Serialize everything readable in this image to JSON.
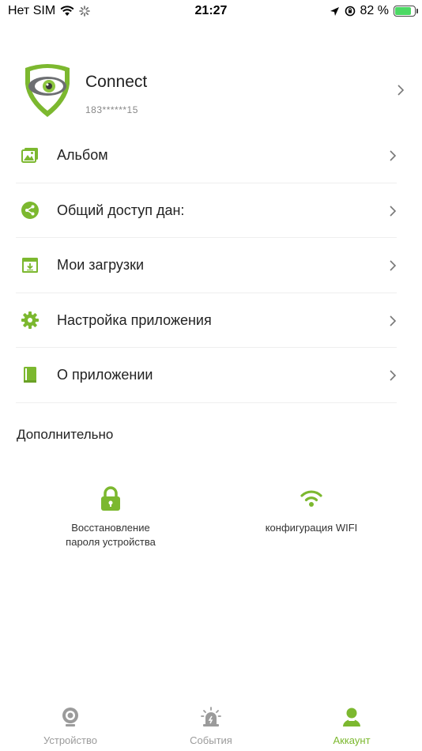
{
  "status_bar": {
    "carrier": "Нет SIM",
    "time": "21:27",
    "battery_percent": "82 %",
    "battery_level": 0.82
  },
  "profile": {
    "name": "Connect",
    "account_id": "183******15"
  },
  "menu": {
    "items": [
      {
        "label": "Альбом",
        "icon": "album-icon"
      },
      {
        "label": "Общий доступ дан:",
        "icon": "share-icon"
      },
      {
        "label": "Мои загрузки",
        "icon": "downloads-icon"
      },
      {
        "label": "Настройка приложения",
        "icon": "gear-icon"
      },
      {
        "label": "О приложении",
        "icon": "book-icon"
      }
    ]
  },
  "additional": {
    "title": "Дополнительно",
    "items": [
      {
        "label_line1": "Восстановление",
        "label_line2": "пароля устройства",
        "icon": "lock-icon"
      },
      {
        "label_line1": "конфигурация WIFI",
        "icon": "wifi-icon"
      }
    ]
  },
  "tabs": [
    {
      "label": "Устройство",
      "icon": "camera-icon",
      "active": false
    },
    {
      "label": "События",
      "icon": "alarm-icon",
      "active": false
    },
    {
      "label": "Аккаунт",
      "icon": "account-icon",
      "active": true
    }
  ],
  "colors": {
    "accent": "#7cb82f",
    "inactive": "#9b9b9b",
    "divider": "#eeeeee"
  }
}
